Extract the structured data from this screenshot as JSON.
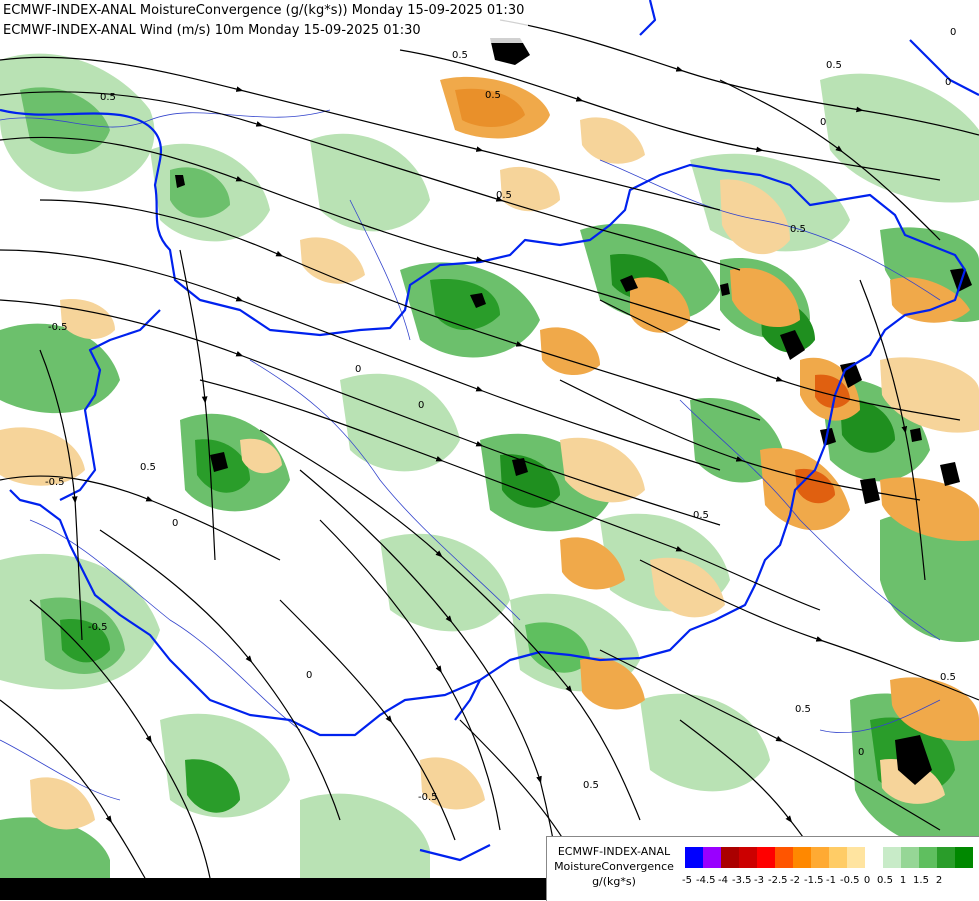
{
  "titles": {
    "line1": "ECMWF-INDEX-ANAL MoistureConvergence (g/(kg*s)) Monday 15-09-2025 01:30",
    "line2": "ECMWF-INDEX-ANAL Wind (m/s) 10m Monday 15-09-2025 01:30"
  },
  "legend": {
    "model": "ECMWF-INDEX-ANAL",
    "variable": "MoistureConvergence",
    "unit": "g/(kg*s)",
    "ticks": [
      "-5",
      "-4.5",
      "-4",
      "-3.5",
      "-3",
      "-2.5",
      "-2",
      "-1.5",
      "-1",
      "-0.5",
      "0",
      "0.5",
      "1",
      "1.5",
      "2"
    ],
    "colors": [
      "#0000ff",
      "#9900ff",
      "#aa0000",
      "#cc0000",
      "#ff0000",
      "#ff5500",
      "#ff8800",
      "#ffaa33",
      "#ffcc66",
      "#ffe4a0",
      "#ffffff",
      "#c8ebc8",
      "#96d696",
      "#5fbf5f",
      "#2a9d2a",
      "#008800"
    ]
  },
  "contour_labels": [
    "0.5",
    "0.5",
    "0.5",
    "0.5",
    "0",
    "0",
    "-0.5",
    "-0.5",
    "-0.5",
    "0",
    "0",
    "0",
    "0.5",
    "0.5",
    "0",
    "0.5",
    "0",
    "0",
    "0.5",
    "-0.5",
    "0.5",
    "0.5",
    "0.5"
  ],
  "map_colors": {
    "border": "#0022ee",
    "river": "#3344cc",
    "streamline": "#000000",
    "convergence_strong": "#1f8f1f",
    "convergence_mid": "#6cc06c",
    "convergence_weak": "#b9e2b4",
    "divergence_weak": "#f6d49a",
    "divergence_mid": "#f0a94a",
    "divergence_strong": "#e06010",
    "peak_black": "#000000"
  }
}
